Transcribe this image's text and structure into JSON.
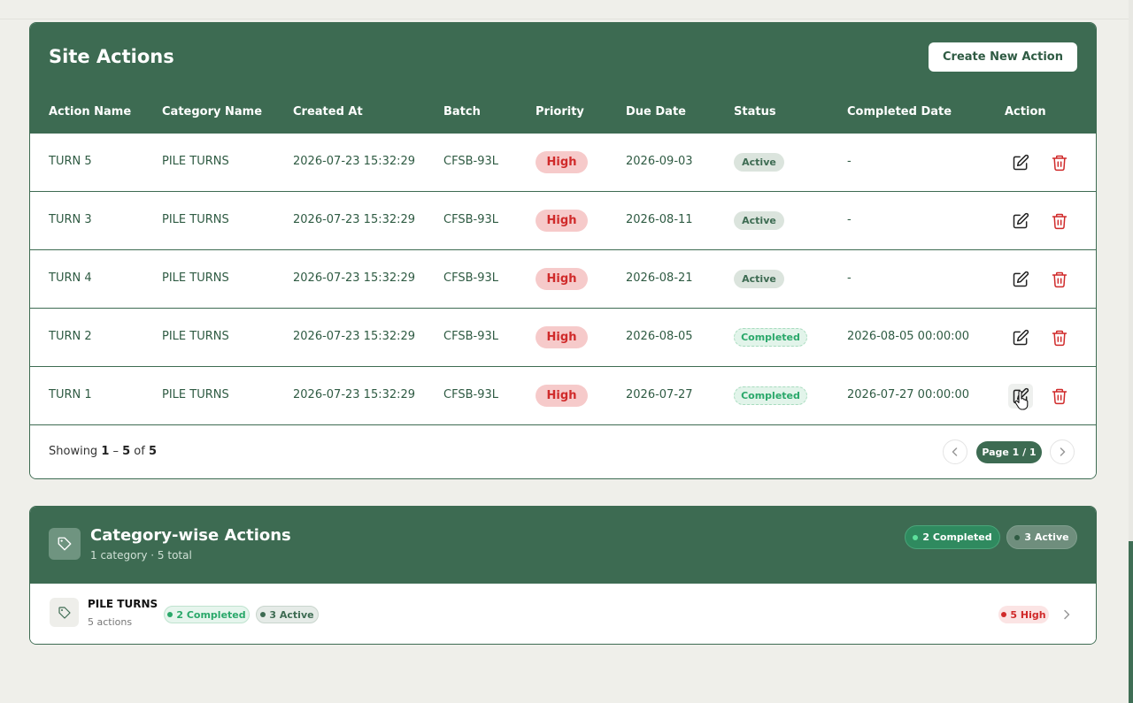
{
  "site_actions": {
    "title": "Site Actions",
    "create_button": "Create New Action",
    "columns": [
      "Action Name",
      "Category Name",
      "Created At",
      "Batch",
      "Priority",
      "Due Date",
      "Status",
      "Completed Date",
      "Action"
    ],
    "rows": [
      {
        "name": "TURN 5",
        "category": "PILE TURNS",
        "created": "2026-07-23 15:32:29",
        "batch": "CFSB-93L",
        "priority": "High",
        "due": "2026-09-03",
        "status": "Active",
        "completed": "-"
      },
      {
        "name": "TURN 3",
        "category": "PILE TURNS",
        "created": "2026-07-23 15:32:29",
        "batch": "CFSB-93L",
        "priority": "High",
        "due": "2026-08-11",
        "status": "Active",
        "completed": "-"
      },
      {
        "name": "TURN 4",
        "category": "PILE TURNS",
        "created": "2026-07-23 15:32:29",
        "batch": "CFSB-93L",
        "priority": "High",
        "due": "2026-08-21",
        "status": "Active",
        "completed": "-"
      },
      {
        "name": "TURN 2",
        "category": "PILE TURNS",
        "created": "2026-07-23 15:32:29",
        "batch": "CFSB-93L",
        "priority": "High",
        "due": "2026-08-05",
        "status": "Completed",
        "completed": "2026-08-05 00:00:00"
      },
      {
        "name": "TURN 1",
        "category": "PILE TURNS",
        "created": "2026-07-23 15:32:29",
        "batch": "CFSB-93L",
        "priority": "High",
        "due": "2026-07-27",
        "status": "Completed",
        "completed": "2026-07-27 00:00:00"
      }
    ],
    "footer": {
      "showing_prefix": "Showing ",
      "range_start": "1",
      "range_sep": " – ",
      "range_end": "5",
      "of_text": " of ",
      "total": "5",
      "page_label": "Page 1 / 1"
    }
  },
  "category_actions": {
    "title": "Category-wise Actions",
    "subtitle": "1 category · 5 total",
    "completed_badge": "2 Completed",
    "active_badge": "3 Active",
    "items": [
      {
        "name": "PILE TURNS",
        "count": "5 actions",
        "completed_badge": "2 Completed",
        "active_badge": "3 Active",
        "high_badge": "5 High"
      }
    ]
  },
  "colors": {
    "brand_green": "#3d6b52",
    "high_red": "#d02a2a",
    "completed_green": "#2aa86a"
  },
  "icons": [
    "edit-icon",
    "trash-icon",
    "tag-icon",
    "chevron-left-icon",
    "chevron-right-icon",
    "hand-pointer-icon"
  ]
}
